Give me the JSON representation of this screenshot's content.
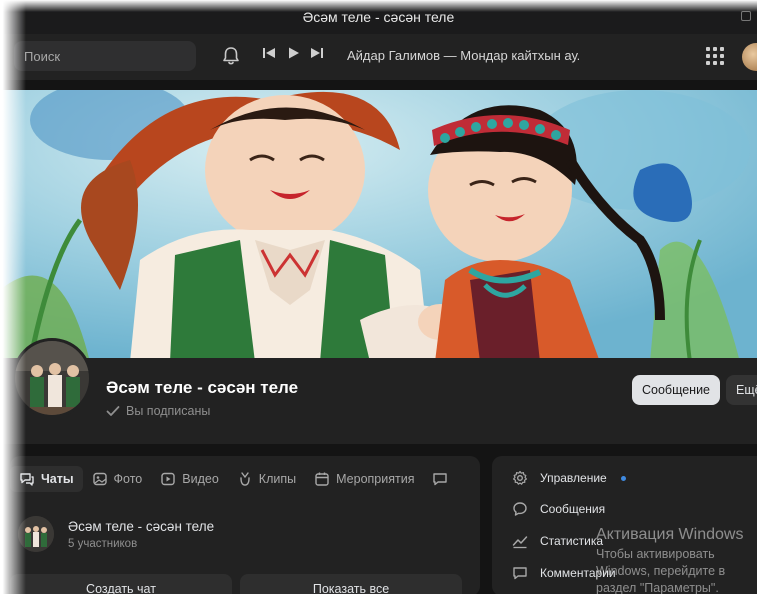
{
  "window": {
    "title": "Әсәм теле - сәсән теле"
  },
  "topnav": {
    "search_placeholder": "Поиск",
    "now_playing": "Айдар Галимов — Мондар кайтхын ау..."
  },
  "group": {
    "name": "Әсәм теле - сәсән теле",
    "status": "Вы подписаны",
    "message_button": "Сообщение",
    "more_button": "Ещё"
  },
  "tabs": [
    {
      "label": "Чаты",
      "icon": "chat-icon",
      "active": true
    },
    {
      "label": "Фото",
      "icon": "photo-icon"
    },
    {
      "label": "Видео",
      "icon": "video-icon"
    },
    {
      "label": "Клипы",
      "icon": "clips-icon"
    },
    {
      "label": "Мероприятия",
      "icon": "calendar-icon"
    }
  ],
  "chat": {
    "name": "Әсәм теле - сәсән теле",
    "members": "5 участников",
    "create_button": "Создать чат",
    "show_all_button": "Показать все"
  },
  "admin_menu": [
    {
      "label": "Управление",
      "icon": "settings-icon",
      "dot": true
    },
    {
      "label": "Сообщения",
      "icon": "message-icon"
    },
    {
      "label": "Статистика",
      "icon": "stats-icon"
    },
    {
      "label": "Комментарии",
      "icon": "comment-icon"
    }
  ],
  "activation": {
    "title": "Активация Windows",
    "body": "Чтобы активировать Windows, перейдите в раздел \"Параметры\"."
  },
  "colors": {
    "background": "#141414",
    "card": "#222222",
    "accent_dot": "#3f8ae0",
    "primary_button": "#e1e3e6"
  }
}
